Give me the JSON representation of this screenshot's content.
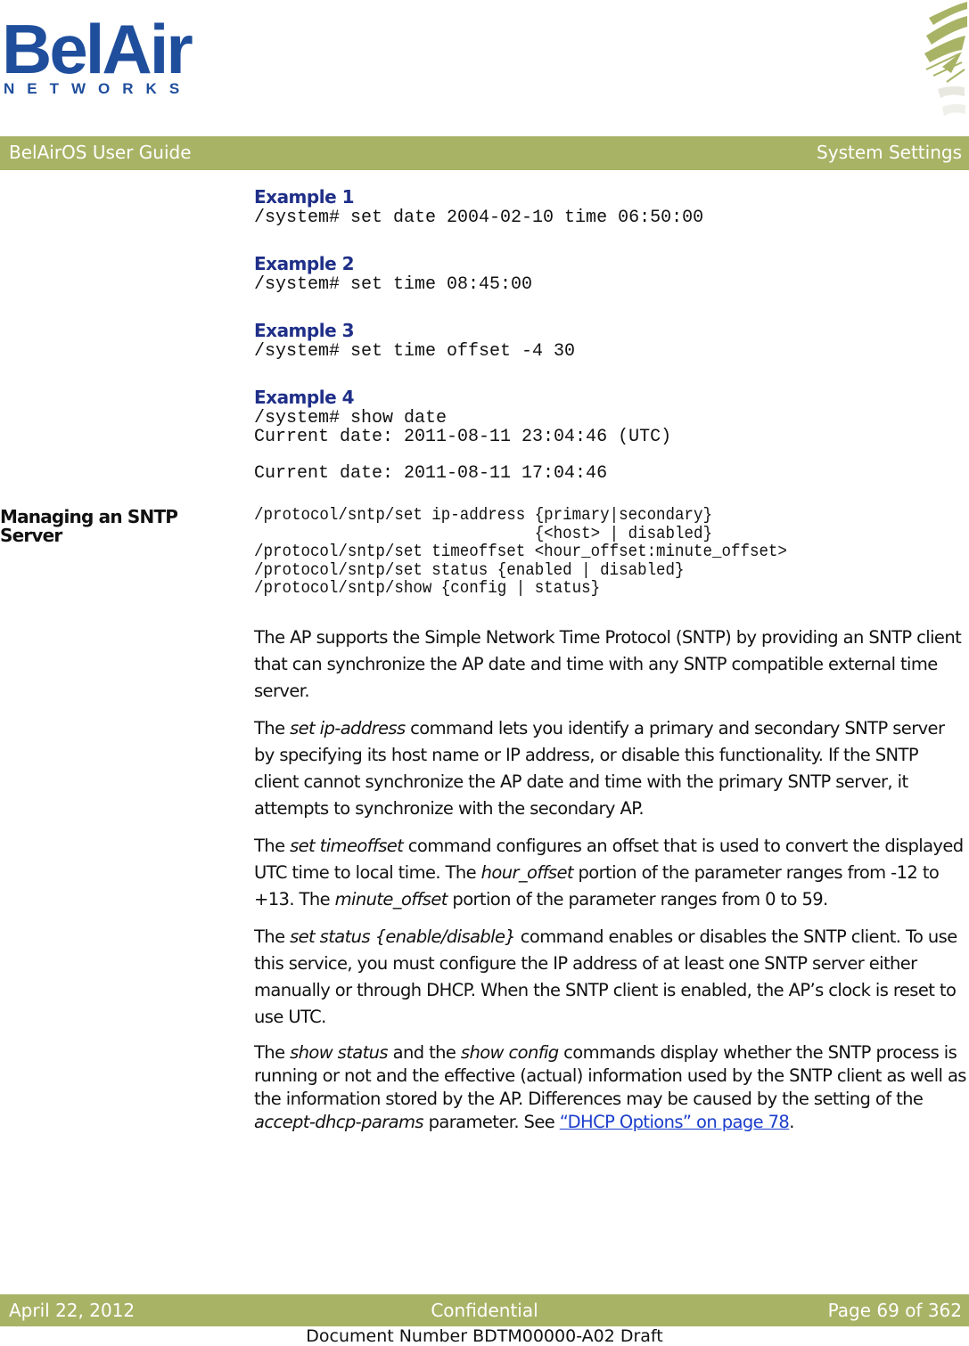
{
  "header": {
    "logo_text": "BelAir",
    "logo_subtext": "NETWORKS",
    "guide_title": "BelAirOS User Guide",
    "section_title": "System Settings"
  },
  "examples": [
    {
      "heading": "Example 1",
      "lines": [
        "/system# set date 2004-02-10 time 06:50:00"
      ]
    },
    {
      "heading": "Example 2",
      "lines": [
        "/system# set time 08:45:00"
      ]
    },
    {
      "heading": "Example 3",
      "lines": [
        "/system# set time offset -4 30"
      ]
    },
    {
      "heading": "Example 4",
      "lines": [
        "/system# show date",
        "Current date: 2011-08-11 23:04:46 (UTC)",
        "",
        "Current date: 2011-08-11 17:04:46"
      ]
    }
  ],
  "sntp_section": {
    "heading": "Managing an SNTP Server",
    "syntax": [
      "/protocol/sntp/set ip-address {primary|secondary}",
      "                              {<host> | disabled}",
      "/protocol/sntp/set timeoffset <hour_offset:minute_offset>",
      "/protocol/sntp/set status {enabled | disabled}",
      "/protocol/sntp/show {config | status}"
    ],
    "para1": "The AP supports the Simple Network Time Protocol (SNTP) by providing an SNTP client that can synchronize the AP date and time with any SNTP compatible external time server.",
    "para2": {
      "pre": "The ",
      "em1": "set ip-address",
      "post": " command lets you identify a primary and secondary SNTP server by specifying its host name or IP address, or disable this functionality. If the SNTP client cannot synchronize the AP date and time with the primary SNTP server, it attempts to synchronize with the secondary AP."
    },
    "para3": {
      "pre": "The ",
      "em1": "set timeoffset",
      "mid1": " command configures an offset that is used to convert the displayed UTC time to local time. The ",
      "em2": "hour_offset",
      "mid2": " portion of the parameter ranges from -12 to +13. The ",
      "em3": "minute_offset",
      "post": " portion of the parameter ranges from 0 to 59."
    },
    "para4": {
      "pre": "The ",
      "em1": "set status {enable/disable}",
      "post": " command enables or disables the SNTP client. To use this service, you must configure the IP address of at least one SNTP server either manually or through DHCP. When the SNTP client is enabled, the AP’s clock is reset to use UTC."
    },
    "para5": {
      "pre": "The ",
      "em1": "show status",
      "mid1": " and the ",
      "em2": "show config",
      "mid2": " commands display whether the SNTP process is running or not and the effective (actual) information used by the SNTP client as well as the information stored by the AP. Differences may be caused by the setting of the ",
      "em3": "accept-dhcp-params",
      "mid3": " parameter. See ",
      "link": "“DHCP Options” on page 78",
      "post": "."
    }
  },
  "footer": {
    "date": "April 22, 2012",
    "classification": "Confidential",
    "page": "Page 69 of 362",
    "document_number": "Document Number BDTM00000-A02 Draft"
  },
  "colors": {
    "band": "#a9b366",
    "heading_blue": "#1f2f88",
    "logo_blue": "#1f4e9c",
    "link": "#1a3dcc"
  }
}
